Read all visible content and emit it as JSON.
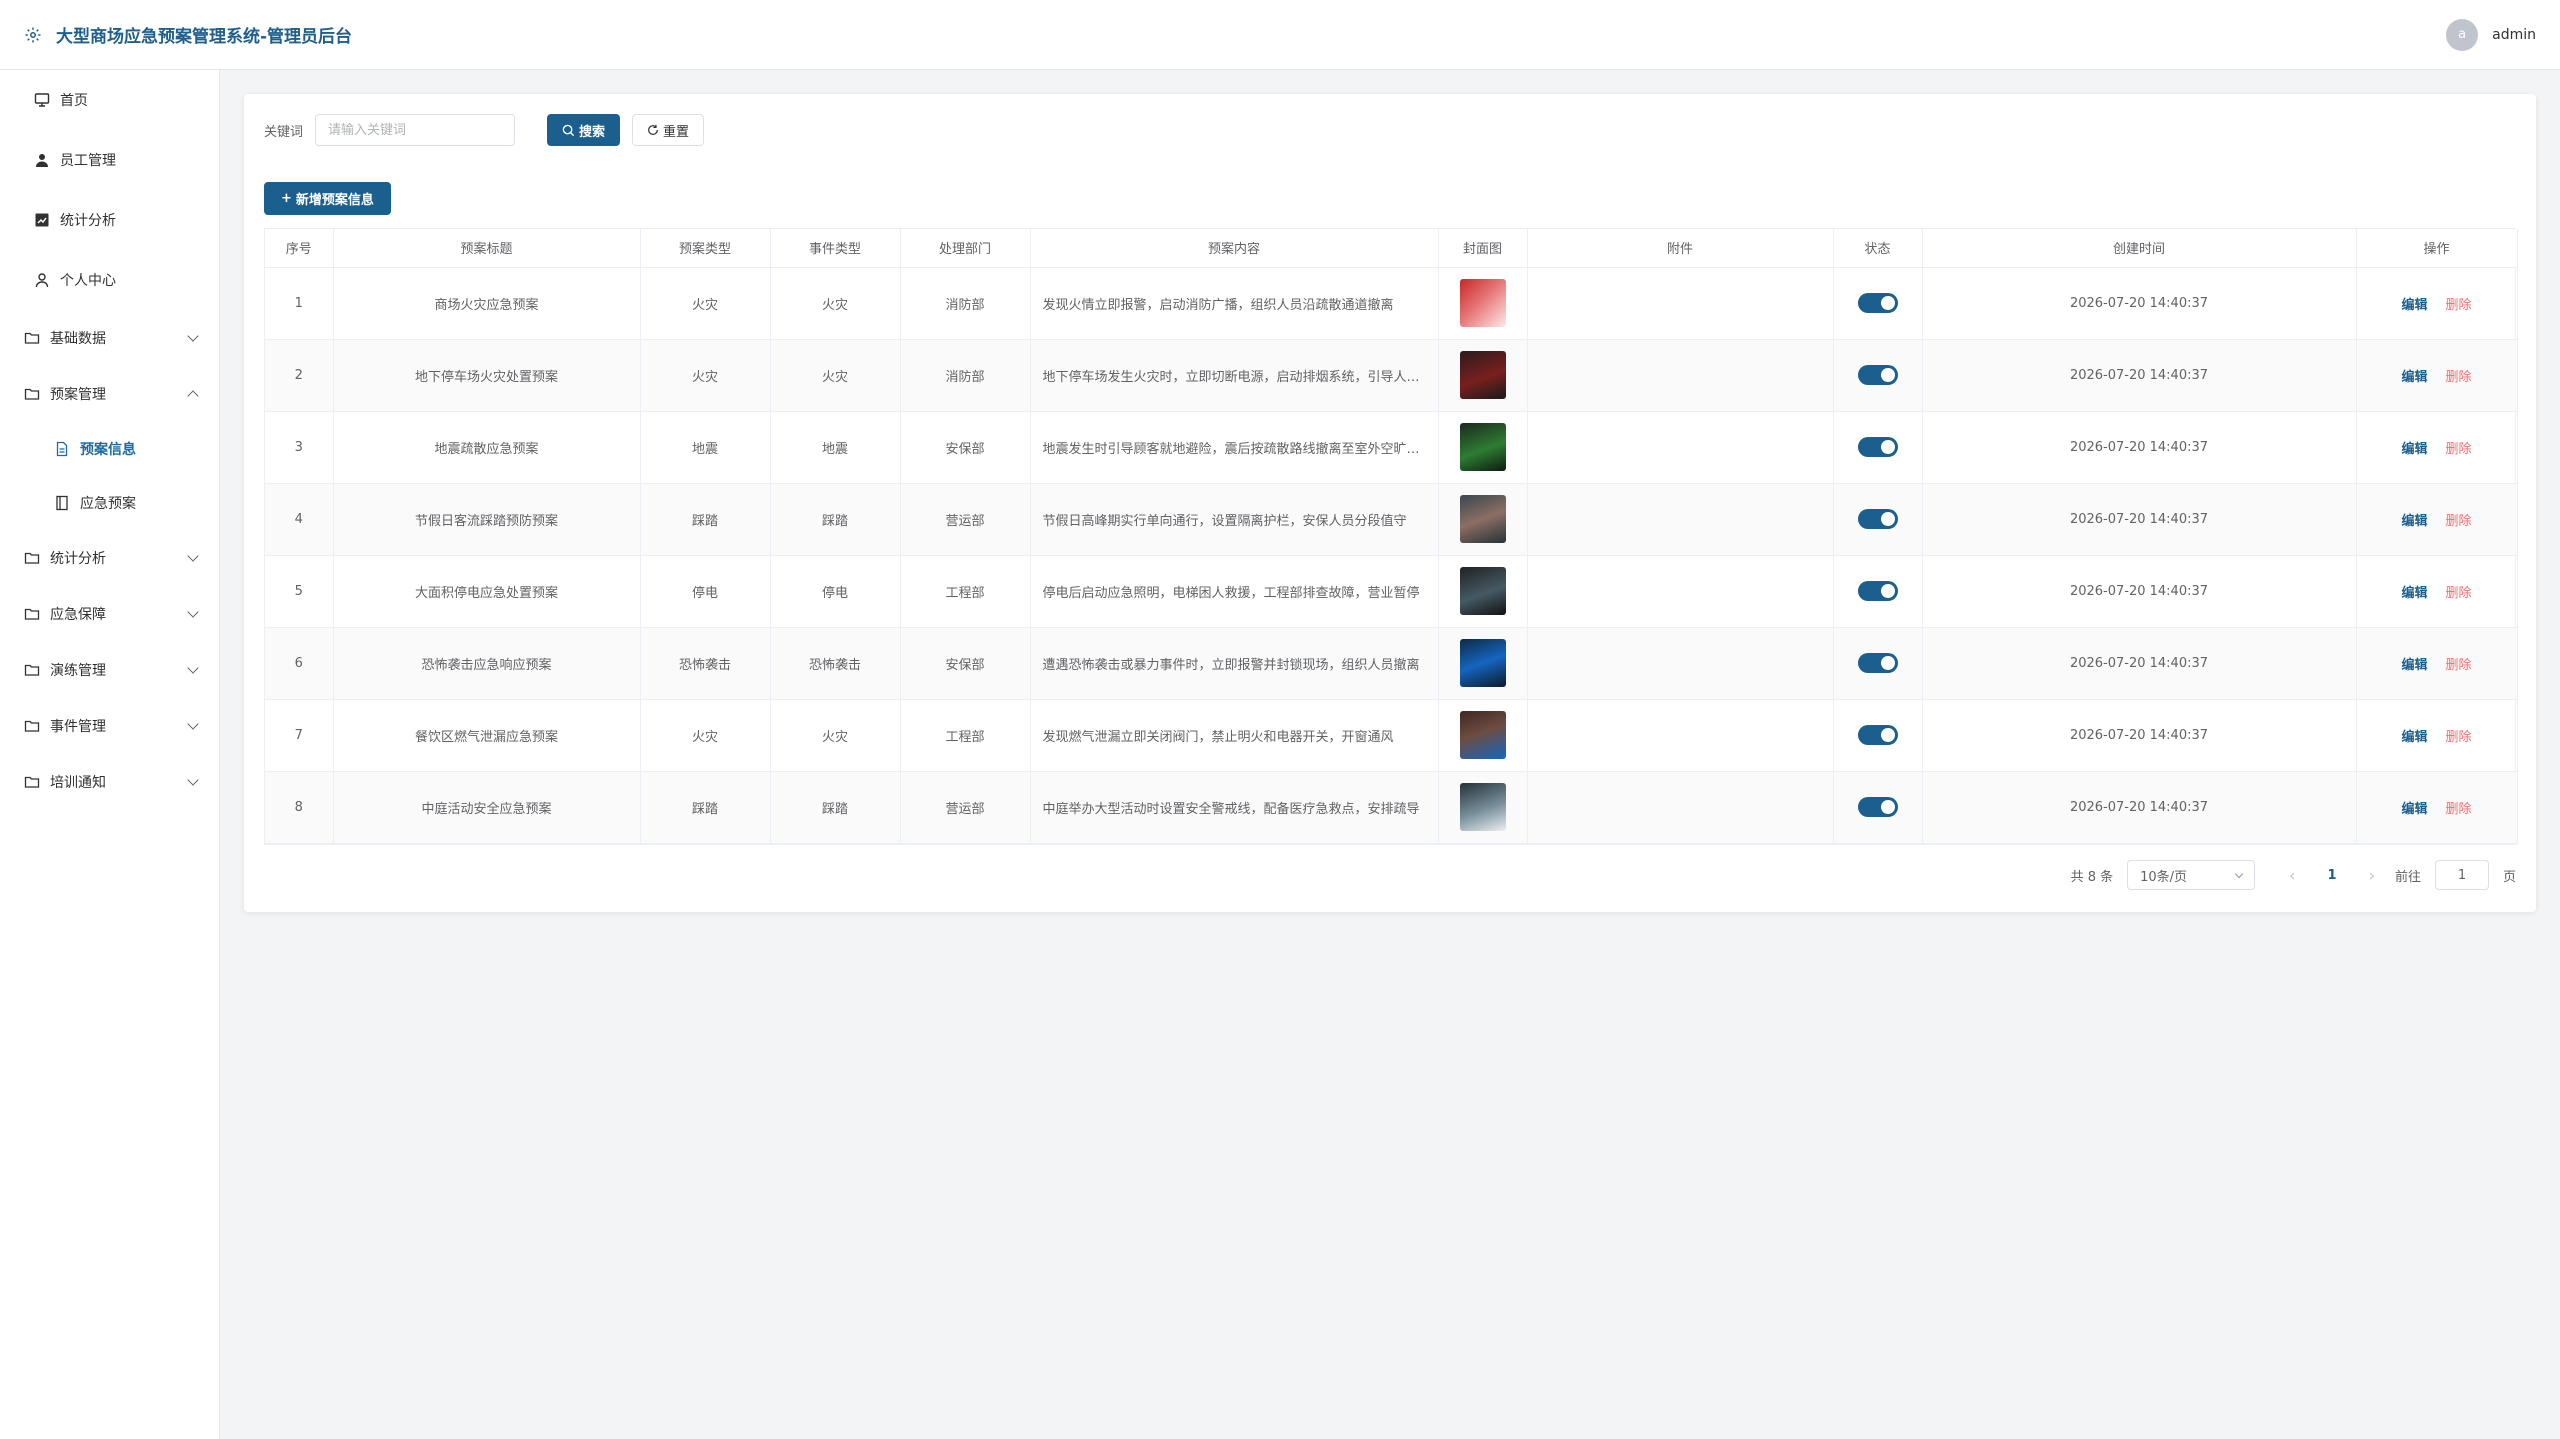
{
  "header": {
    "title": "大型商场应急预案管理系统-管理员后台",
    "username": "admin",
    "avatar_initial": "a"
  },
  "sidebar": {
    "top_items": [
      {
        "label": "首页",
        "icon": "monitor-icon"
      },
      {
        "label": "员工管理",
        "icon": "user-icon"
      },
      {
        "label": "统计分析",
        "icon": "chart-icon"
      },
      {
        "label": "个人中心",
        "icon": "person-icon"
      }
    ],
    "groups": [
      {
        "label": "基础数据",
        "expanded": false
      },
      {
        "label": "预案管理",
        "expanded": true,
        "children": [
          {
            "label": "预案信息",
            "active": true
          },
          {
            "label": "应急预案",
            "active": false
          }
        ]
      },
      {
        "label": "统计分析",
        "expanded": false
      },
      {
        "label": "应急保障",
        "expanded": false
      },
      {
        "label": "演练管理",
        "expanded": false
      },
      {
        "label": "事件管理",
        "expanded": false
      },
      {
        "label": "培训通知",
        "expanded": false
      }
    ]
  },
  "search": {
    "label": "关键词",
    "placeholder": "请输入关键词",
    "search_button": "搜索",
    "reset_button": "重置"
  },
  "add_button": "新增预案信息",
  "table": {
    "columns": [
      "序号",
      "预案标题",
      "预案类型",
      "事件类型",
      "处理部门",
      "预案内容",
      "封面图",
      "附件",
      "状态",
      "创建时间",
      "操作"
    ],
    "edit_label": "编辑",
    "delete_label": "删除",
    "rows": [
      {
        "no": "1",
        "title": "商场火灾应急预案",
        "plan_type": "火灾",
        "event_type": "火灾",
        "dept": "消防部",
        "content": "发现火情立即报警，启动消防广播，组织人员沿疏散通道撤离",
        "attachment": "",
        "status": true,
        "created": "2026-07-20 14:40:37",
        "cover": "cover-red"
      },
      {
        "no": "2",
        "title": "地下停车场火灾处置预案",
        "plan_type": "火灾",
        "event_type": "火灾",
        "dept": "消防部",
        "content": "地下停车场发生火灾时，立即切断电源，启动排烟系统，引导人员疏散",
        "attachment": "",
        "status": true,
        "created": "2026-07-20 14:40:37",
        "cover": "cover-dark"
      },
      {
        "no": "3",
        "title": "地震疏散应急预案",
        "plan_type": "地震",
        "event_type": "地震",
        "dept": "安保部",
        "content": "地震发生时引导顾客就地避险，震后按疏散路线撤离至室外空旷地带",
        "attachment": "",
        "status": true,
        "created": "2026-07-20 14:40:37",
        "cover": "cover-green"
      },
      {
        "no": "4",
        "title": "节假日客流踩踏预防预案",
        "plan_type": "踩踏",
        "event_type": "踩踏",
        "dept": "营运部",
        "content": "节假日高峰期实行单向通行，设置隔离护栏，安保人员分段值守",
        "attachment": "",
        "status": true,
        "created": "2026-07-20 14:40:37",
        "cover": "cover-crowd"
      },
      {
        "no": "5",
        "title": "大面积停电应急处置预案",
        "plan_type": "停电",
        "event_type": "停电",
        "dept": "工程部",
        "content": "停电后启动应急照明，电梯困人救援，工程部排查故障，营业暂停",
        "attachment": "",
        "status": true,
        "created": "2026-07-20 14:40:37",
        "cover": "cover-night"
      },
      {
        "no": "6",
        "title": "恐怖袭击应急响应预案",
        "plan_type": "恐怖袭击",
        "event_type": "恐怖袭击",
        "dept": "安保部",
        "content": "遭遇恐怖袭击或暴力事件时，立即报警并封锁现场，组织人员撤离",
        "attachment": "",
        "status": true,
        "created": "2026-07-20 14:40:37",
        "cover": "cover-blue"
      },
      {
        "no": "7",
        "title": "餐饮区燃气泄漏应急预案",
        "plan_type": "火灾",
        "event_type": "火灾",
        "dept": "工程部",
        "content": "发现燃气泄漏立即关闭阀门，禁止明火和电器开关，开窗通风",
        "attachment": "",
        "status": true,
        "created": "2026-07-20 14:40:37",
        "cover": "cover-shop"
      },
      {
        "no": "8",
        "title": "中庭活动安全应急预案",
        "plan_type": "踩踏",
        "event_type": "踩踏",
        "dept": "营运部",
        "content": "中庭举办大型活动时设置安全警戒线，配备医疗急救点，安排疏导",
        "attachment": "",
        "status": true,
        "created": "2026-07-20 14:40:37",
        "cover": "cover-gray"
      }
    ]
  },
  "pagination": {
    "total_text": "共 8 条",
    "page_size": "10条/页",
    "current_page": "1",
    "goto_label": "前往",
    "goto_value": "1",
    "page_suffix": "页"
  },
  "colors": {
    "primary": "#1a5f8e",
    "danger": "#f56c6c"
  }
}
